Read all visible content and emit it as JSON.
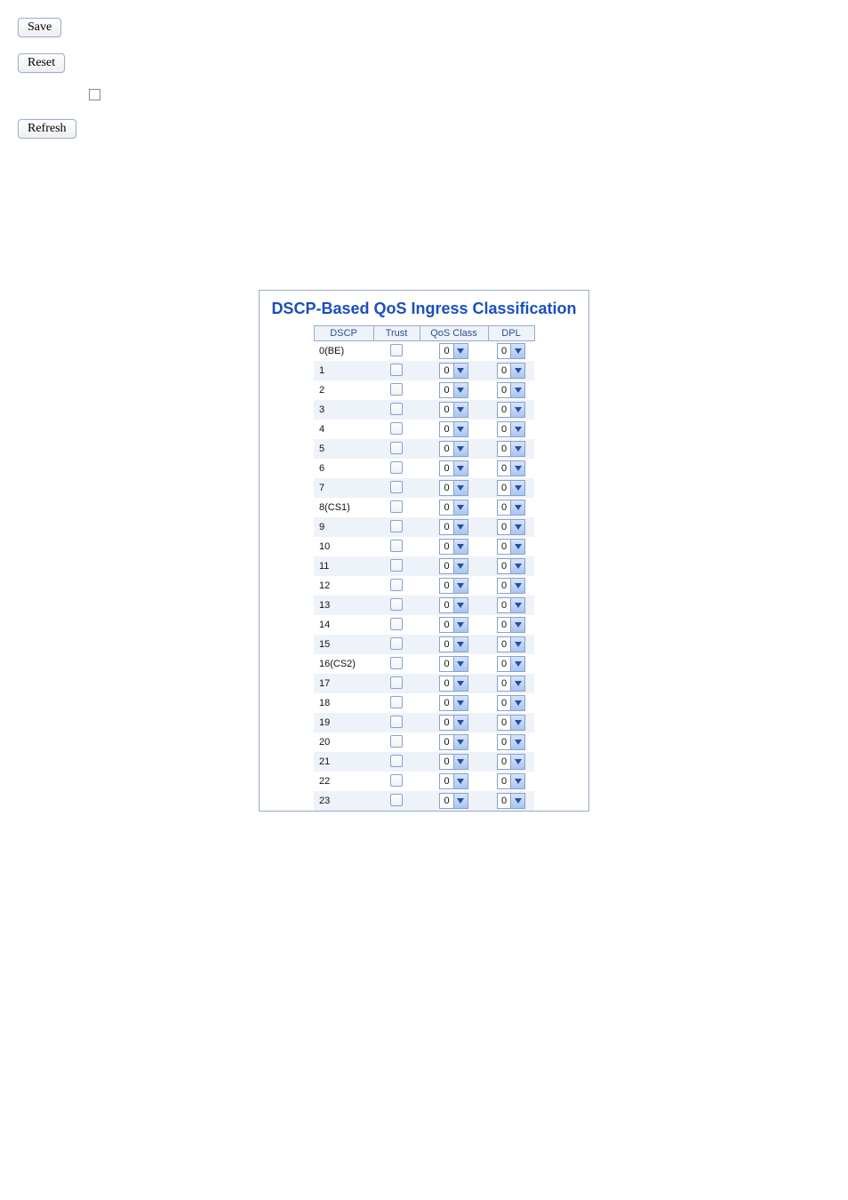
{
  "buttons": {
    "save": "Save",
    "reset": "Reset",
    "refresh": "Refresh"
  },
  "title": "DSCP-Based QoS Ingress Classification",
  "headers": {
    "dscp": "DSCP",
    "trust": "Trust",
    "qos": "QoS Class",
    "dpl": "DPL"
  },
  "rows": [
    {
      "label": "0(BE)",
      "trust": false,
      "qos": "0",
      "dpl": "0"
    },
    {
      "label": "1",
      "trust": false,
      "qos": "0",
      "dpl": "0"
    },
    {
      "label": "2",
      "trust": false,
      "qos": "0",
      "dpl": "0"
    },
    {
      "label": "3",
      "trust": false,
      "qos": "0",
      "dpl": "0"
    },
    {
      "label": "4",
      "trust": false,
      "qos": "0",
      "dpl": "0"
    },
    {
      "label": "5",
      "trust": false,
      "qos": "0",
      "dpl": "0"
    },
    {
      "label": "6",
      "trust": false,
      "qos": "0",
      "dpl": "0"
    },
    {
      "label": "7",
      "trust": false,
      "qos": "0",
      "dpl": "0"
    },
    {
      "label": "8(CS1)",
      "trust": false,
      "qos": "0",
      "dpl": "0"
    },
    {
      "label": "9",
      "trust": false,
      "qos": "0",
      "dpl": "0"
    },
    {
      "label": "10",
      "trust": false,
      "qos": "0",
      "dpl": "0"
    },
    {
      "label": "11",
      "trust": false,
      "qos": "0",
      "dpl": "0"
    },
    {
      "label": "12",
      "trust": false,
      "qos": "0",
      "dpl": "0"
    },
    {
      "label": "13",
      "trust": false,
      "qos": "0",
      "dpl": "0"
    },
    {
      "label": "14",
      "trust": false,
      "qos": "0",
      "dpl": "0"
    },
    {
      "label": "15",
      "trust": false,
      "qos": "0",
      "dpl": "0"
    },
    {
      "label": "16(CS2)",
      "trust": false,
      "qos": "0",
      "dpl": "0"
    },
    {
      "label": "17",
      "trust": false,
      "qos": "0",
      "dpl": "0"
    },
    {
      "label": "18",
      "trust": false,
      "qos": "0",
      "dpl": "0"
    },
    {
      "label": "19",
      "trust": false,
      "qos": "0",
      "dpl": "0"
    },
    {
      "label": "20",
      "trust": false,
      "qos": "0",
      "dpl": "0"
    },
    {
      "label": "21",
      "trust": false,
      "qos": "0",
      "dpl": "0"
    },
    {
      "label": "22",
      "trust": false,
      "qos": "0",
      "dpl": "0"
    },
    {
      "label": "23",
      "trust": false,
      "qos": "0",
      "dpl": "0"
    }
  ]
}
